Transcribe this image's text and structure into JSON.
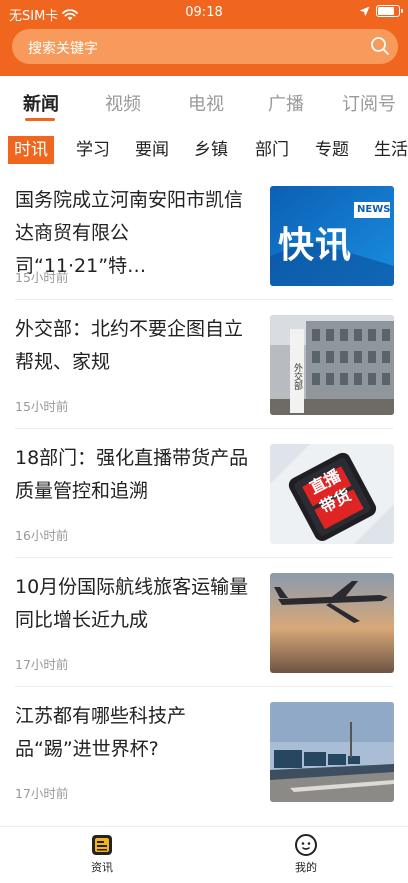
{
  "status_bar": {
    "carrier": "无SIM卡",
    "time": "09:18",
    "battery_level": 0.85
  },
  "search": {
    "placeholder": "搜索关键字"
  },
  "channels": [
    {
      "label": "新闻",
      "active": true
    },
    {
      "label": "视频",
      "active": false
    },
    {
      "label": "电视",
      "active": false
    },
    {
      "label": "广播",
      "active": false
    },
    {
      "label": "订阅号",
      "active": false
    }
  ],
  "subtabs": [
    {
      "label": "时讯",
      "active": true
    },
    {
      "label": "学习",
      "active": false
    },
    {
      "label": "要闻",
      "active": false
    },
    {
      "label": "乡镇",
      "active": false
    },
    {
      "label": "部门",
      "active": false
    },
    {
      "label": "专题",
      "active": false
    },
    {
      "label": "生活",
      "active": false
    }
  ],
  "news": [
    {
      "title": "国务院成立河南安阳市凯信达商贸有限公司“11·21”特…",
      "time": "15小时前",
      "thumb": "kuaixun-news-graphic",
      "thumb_text": "快讯",
      "thumb_badge": "NEWS"
    },
    {
      "title": "外交部：北约不要企图自立帮规、家规",
      "time": "15小时前",
      "thumb": "ministry-building-photo",
      "thumb_text": "外交部"
    },
    {
      "title": "18部门：强化直播带货产品质量管控和追溯",
      "time": "16小时前",
      "thumb": "livestream-phone-graphic",
      "thumb_text": "直播带货"
    },
    {
      "title": "10月份国际航线旅客运输量同比增长近九成",
      "time": "17小时前",
      "thumb": "airplane-sunset-photo"
    },
    {
      "title": "江苏都有哪些科技产品“踢”进世界杯?",
      "time": "17小时前",
      "thumb": "electric-bus-lot-photo"
    }
  ],
  "tabbar": [
    {
      "label": "资讯",
      "icon": "news-icon",
      "active": true
    },
    {
      "label": "我的",
      "icon": "profile-icon",
      "active": false
    }
  ],
  "colors": {
    "brand": "#f0661e",
    "search_bg": "#f79a5c"
  }
}
